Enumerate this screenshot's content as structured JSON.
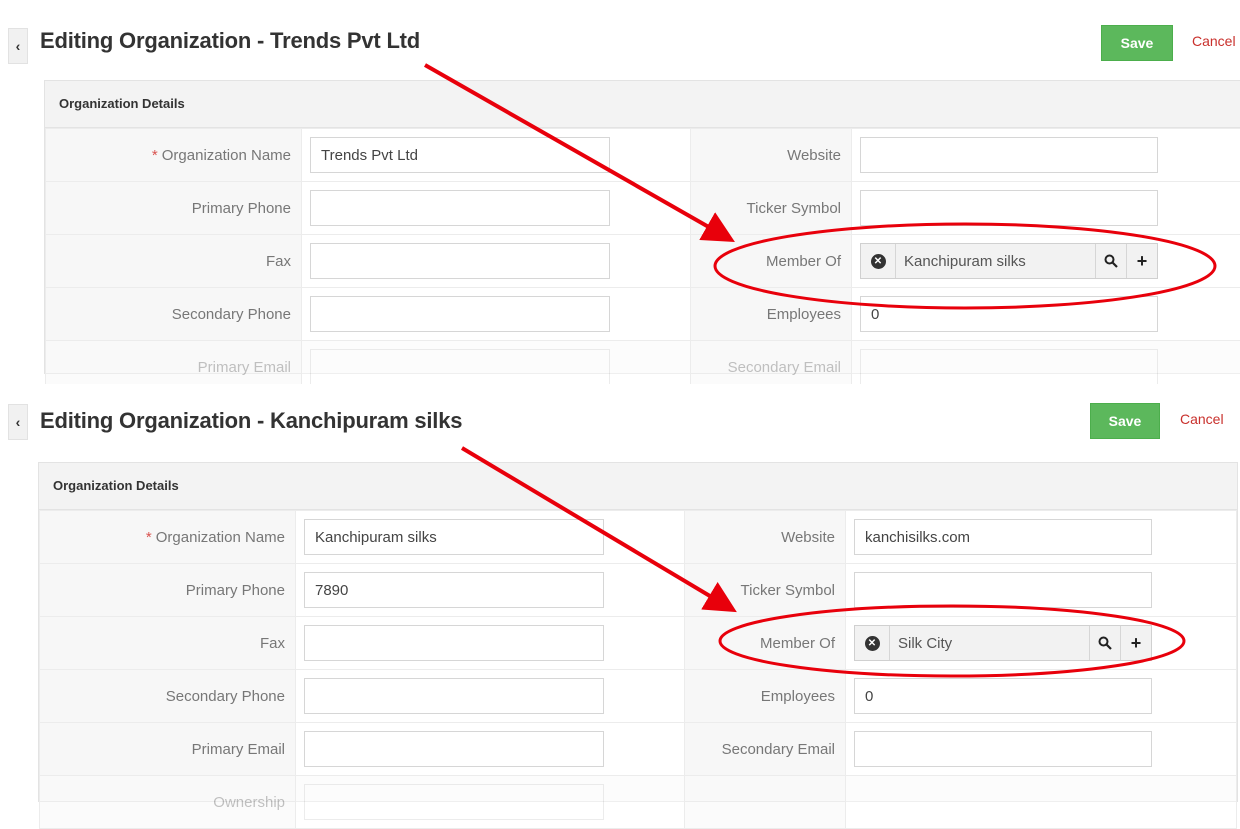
{
  "panels": [
    {
      "title": "Editing Organization - Trends Pvt Ltd",
      "save_label": "Save",
      "cancel_label": "Cancel",
      "block_title": "Organization Details",
      "left_fields": [
        {
          "label": "Organization Name",
          "value": ""
        },
        {
          "label": "Primary Phone",
          "value": ""
        },
        {
          "label": "Fax",
          "value": ""
        },
        {
          "label": "Secondary Phone",
          "value": ""
        },
        {
          "label": "Primary Email",
          "value": ""
        }
      ],
      "org_name_value": "Trends Pvt Ltd",
      "right_fields": [
        {
          "label": "Website",
          "value": ""
        },
        {
          "label": "Ticker Symbol",
          "value": ""
        },
        {
          "label": "Member Of",
          "value": "Kanchipuram silks"
        },
        {
          "label": "Employees",
          "value": "0"
        },
        {
          "label": "Secondary Email",
          "value": ""
        }
      ]
    },
    {
      "title": "Editing Organization - Kanchipuram silks",
      "save_label": "Save",
      "cancel_label": "Cancel",
      "block_title": "Organization Details",
      "left_fields": [
        {
          "label": "Organization Name",
          "value": ""
        },
        {
          "label": "Primary Phone",
          "value": "7890"
        },
        {
          "label": "Fax",
          "value": ""
        },
        {
          "label": "Secondary Phone",
          "value": ""
        },
        {
          "label": "Primary Email",
          "value": ""
        },
        {
          "label": "Ownership",
          "value": ""
        }
      ],
      "org_name_value": "Kanchipuram silks",
      "right_fields": [
        {
          "label": "Website",
          "value": "kanchisilks.com"
        },
        {
          "label": "Ticker Symbol",
          "value": ""
        },
        {
          "label": "Member Of",
          "value": "Silk City"
        },
        {
          "label": "Employees",
          "value": "0"
        },
        {
          "label": "Secondary Email",
          "value": ""
        }
      ]
    }
  ],
  "required_mark": "*",
  "icons": {
    "collapse": "chevron-left-icon",
    "clear": "remove-circle-icon",
    "search": "search-icon",
    "add": "plus-icon"
  },
  "colors": {
    "save_button": "#5cb85c",
    "cancel_link": "#c9302c",
    "annotation": "#e8000b",
    "required": "#d9534f"
  }
}
